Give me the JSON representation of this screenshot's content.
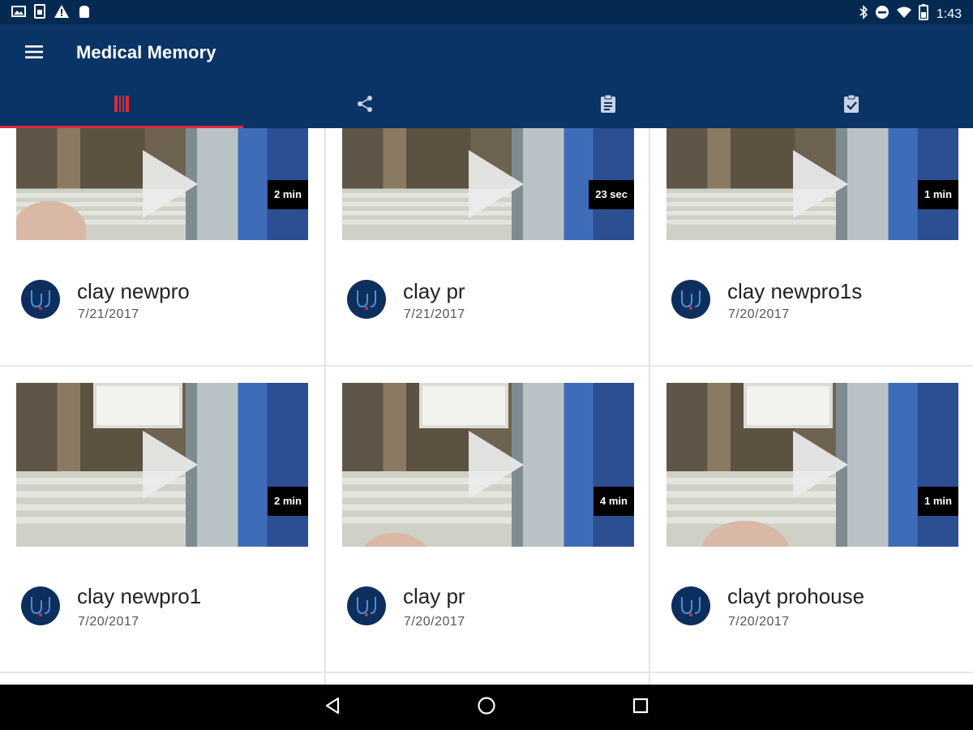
{
  "status_bar": {
    "time": "1:43",
    "left_icons": [
      "image-icon",
      "sim-card-icon",
      "warning-icon",
      "android-icon"
    ],
    "right_icons": [
      "bluetooth-icon",
      "do-not-disturb-icon",
      "wifi-icon",
      "battery-icon"
    ]
  },
  "app_bar": {
    "title": "Medical Memory",
    "menu_icon": "menu-icon"
  },
  "colors": {
    "app_bar": "#0b3466",
    "status_bar": "#052a52",
    "tab_indicator": "#d92b38",
    "avatar": "#0d2f5e"
  },
  "tabs": [
    {
      "icon": "video-list-icon",
      "active": true
    },
    {
      "icon": "share-icon",
      "active": false
    },
    {
      "icon": "clipboard-icon",
      "active": false
    },
    {
      "icon": "clipboard-check-icon",
      "active": false
    }
  ],
  "videos": [
    {
      "title": "clay newpro",
      "date": "7/21/2017",
      "duration": "2 min"
    },
    {
      "title": "clay pr",
      "date": "7/21/2017",
      "duration": "23 sec"
    },
    {
      "title": "clay newpro1s",
      "date": "7/20/2017",
      "duration": "1 min"
    },
    {
      "title": "clay newpro1",
      "date": "7/20/2017",
      "duration": "2 min"
    },
    {
      "title": "clay pr",
      "date": "7/20/2017",
      "duration": "4 min"
    },
    {
      "title": "clayt prohouse",
      "date": "7/20/2017",
      "duration": "1 min"
    }
  ],
  "nav_bar": {
    "buttons": [
      "back-icon",
      "home-icon",
      "recents-icon"
    ]
  }
}
